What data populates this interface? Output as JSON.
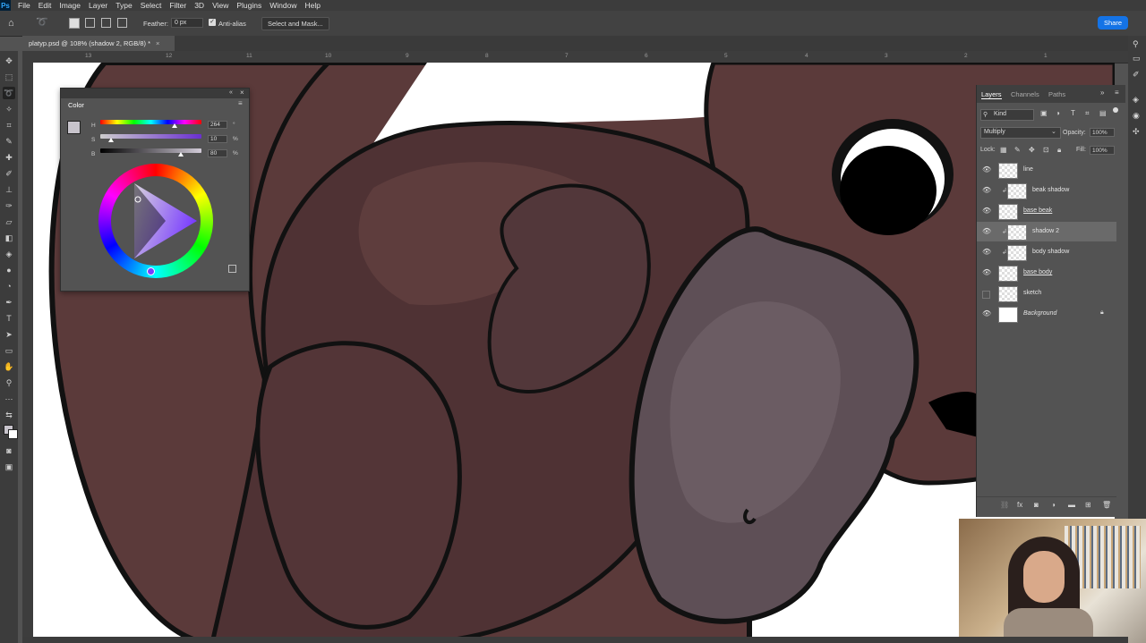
{
  "menubar": {
    "logo": "Ps",
    "items": [
      "File",
      "Edit",
      "Image",
      "Layer",
      "Type",
      "Select",
      "Filter",
      "3D",
      "View",
      "Plugins",
      "Window",
      "Help"
    ]
  },
  "options": {
    "feather_label": "Feather:",
    "feather_value": "0 px",
    "antialias_label": "Anti-alias",
    "select_mask": "Select and Mask...",
    "share": "Share"
  },
  "tab": {
    "title": "platyp.psd @ 108% (shadow 2, RGB/8) *",
    "close": "×"
  },
  "ruler": {
    "ticks": [
      "13",
      "12",
      "11",
      "10",
      "9",
      "8",
      "7",
      "6",
      "5",
      "4",
      "3",
      "2",
      "1"
    ]
  },
  "color_panel": {
    "title": "Color",
    "h_label": "H",
    "h_value": "264",
    "h_unit": "°",
    "s_label": "S",
    "s_value": "10",
    "s_unit": "%",
    "b_label": "B",
    "b_value": "80",
    "b_unit": "%"
  },
  "layers_panel": {
    "tabs": [
      "Layers",
      "Channels",
      "Paths"
    ],
    "filter": "Kind",
    "blend_mode": "Multiply",
    "opacity_label": "Opacity:",
    "opacity_value": "100%",
    "lock_label": "Lock:",
    "fill_label": "Fill:",
    "fill_value": "100%",
    "layers": [
      {
        "name": "line",
        "visible": true,
        "clipped": false,
        "selected": false
      },
      {
        "name": "beak shadow",
        "visible": true,
        "clipped": true,
        "selected": false
      },
      {
        "name": "base beak",
        "visible": true,
        "clipped": false,
        "selected": false
      },
      {
        "name": "shadow 2",
        "visible": true,
        "clipped": true,
        "selected": true
      },
      {
        "name": "body shadow",
        "visible": true,
        "clipped": true,
        "selected": false
      },
      {
        "name": "base body",
        "visible": true,
        "clipped": false,
        "selected": false
      },
      {
        "name": "sketch",
        "visible": false,
        "clipped": false,
        "selected": false
      },
      {
        "name": "Background",
        "visible": true,
        "clipped": false,
        "selected": false
      }
    ]
  },
  "colors": {
    "body": "#5b3a3a",
    "body_shadow": "#4a2f31",
    "beak": "#5e4f56",
    "beak_light": "#6b5c63",
    "line": "#111111",
    "accent": "#1473e6"
  }
}
